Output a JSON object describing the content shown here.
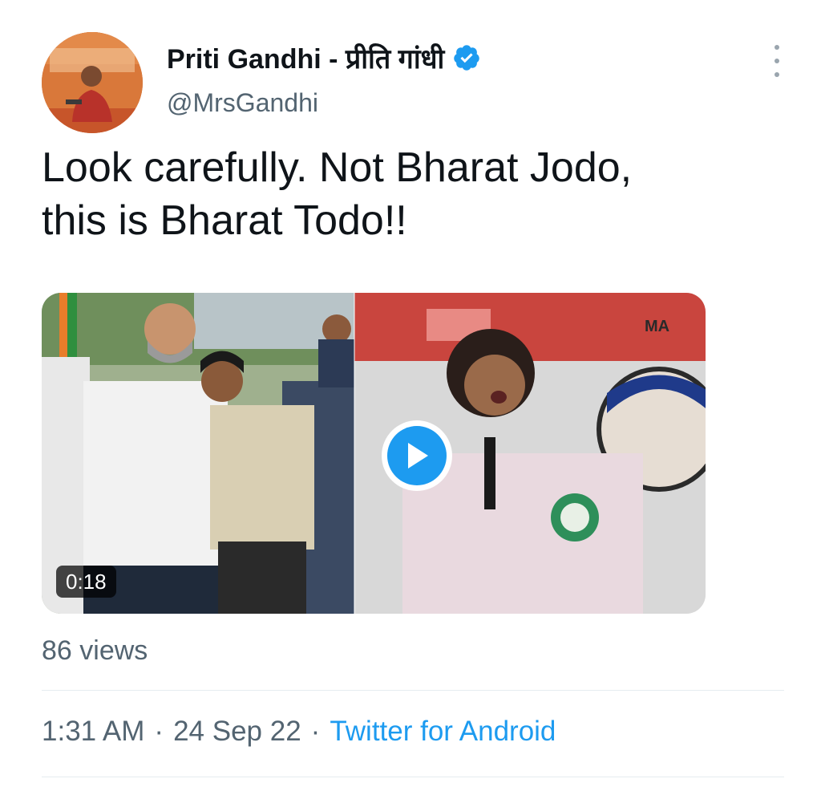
{
  "tweet": {
    "display_name": "Priti Gandhi - प्रीति गांधी",
    "handle": "@MrsGandhi",
    "verified_icon": "verified-badge-icon",
    "more_icon": "more-options-icon",
    "text_line1": "Look carefully. Not Bharat Jodo,",
    "text_line2": "this is Bharat Todo!!"
  },
  "media": {
    "duration": "0:18",
    "play_icon": "play-icon",
    "corner_logo": "MA"
  },
  "stats": {
    "views": "86 views"
  },
  "meta": {
    "time": "1:31 AM",
    "separator": "·",
    "date": "24 Sep 22",
    "source": "Twitter for Android"
  },
  "colors": {
    "accent": "#1d9bf0",
    "secondary_text": "#536471",
    "primary_text": "#0f1419"
  }
}
